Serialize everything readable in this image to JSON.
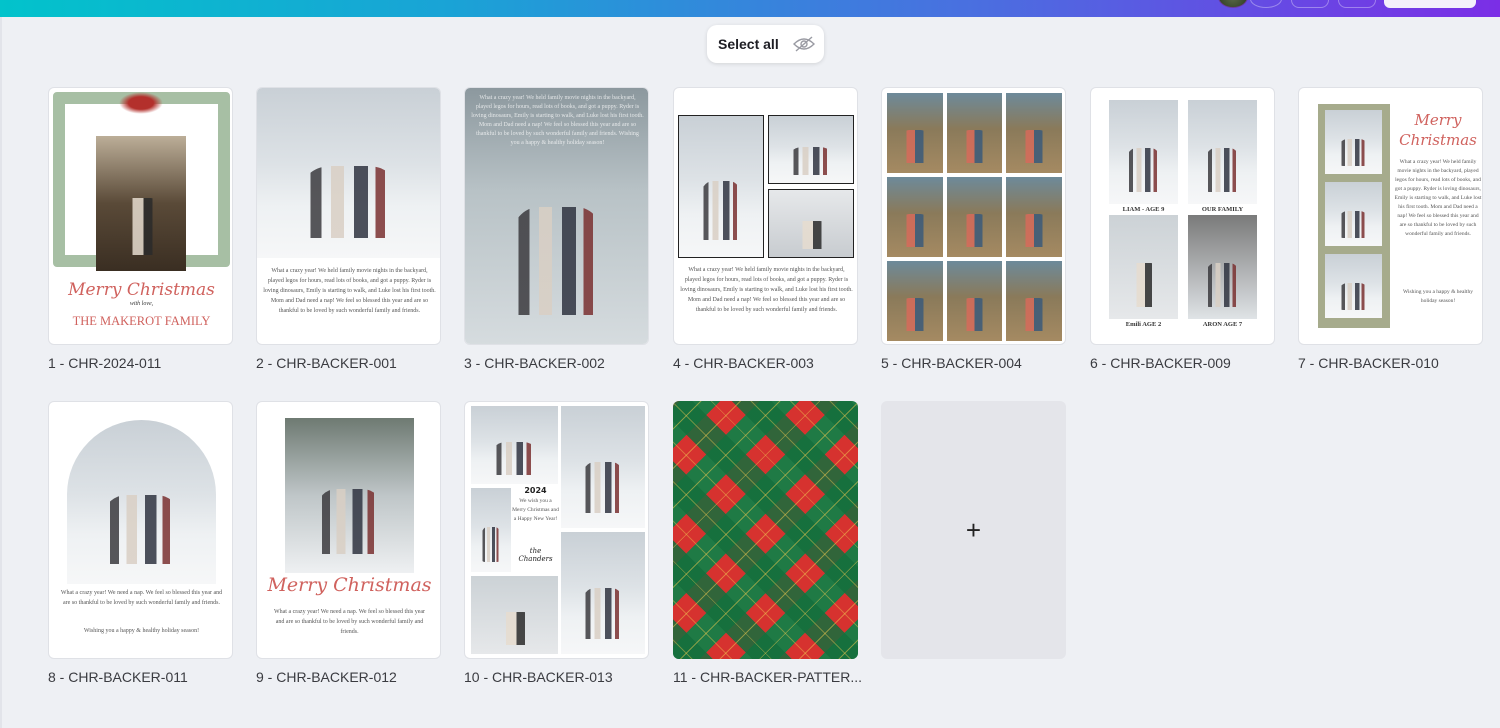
{
  "toolbar": {
    "select_all_label": "Select all",
    "hide_icon": "eye-slash-icon",
    "add_page_icon": "plus-icon",
    "add_page_symbol": "+"
  },
  "colors": {
    "gradient_start": "#02c3cb",
    "gradient_end": "#7b2ee6",
    "background": "#eef0f4"
  },
  "pages": [
    {
      "label": "1 - CHR-2024-011",
      "title": "Merry Christmas",
      "subtitle": "with love,",
      "family": "THE MAKEROT FAMILY"
    },
    {
      "label": "2 - CHR-BACKER-001",
      "body": "What a crazy year! We held family movie nights in the backyard, played legos for hours, read lots of books, and got a puppy. Ryder is loving dinosaurs, Emily is starting to walk, and Luke lost his first tooth. Mom and Dad need a nap! We feel so blessed this year and are so thankful to be loved by such wonderful family and friends."
    },
    {
      "label": "3 - CHR-BACKER-002",
      "body": "What a crazy year! We held family movie nights in the backyard, played legos for hours, read lots of books, and got a puppy. Ryder is loving dinosaurs, Emily is starting to walk, and Luke lost his first tooth. Mom and Dad need a nap! We feel so blessed this year and are so thankful to be loved by such wonderful family and friends. Wishing you a happy & healthy holiday season!"
    },
    {
      "label": "4 - CHR-BACKER-003",
      "body": "What a crazy year! We held family movie nights in the backyard, played legos for hours, read lots of books, and got a puppy. Ryder is loving dinosaurs, Emily is starting to walk, and Luke lost his first tooth. Mom and Dad need a nap! We feel so blessed this year and are so thankful to be loved by such wonderful family and friends."
    },
    {
      "label": "5 - CHR-BACKER-004"
    },
    {
      "label": "6 - CHR-BACKER-009",
      "captions": [
        "LIAM - AGE 9",
        "OUR FAMILY",
        "Emili AGE 2",
        "ARON AGE 7"
      ]
    },
    {
      "label": "7 - CHR-BACKER-010",
      "title": "Merry Christmas",
      "body": "What a crazy year! We held family movie nights in the backyard, played legos for hours, read lots of books, and got a puppy. Ryder is loving dinosaurs, Emily is starting to walk, and Luke lost his first tooth. Mom and Dad need a nap! We feel so blessed this year and are so thankful to be loved by such wonderful family and friends.",
      "closing": "Wishing you a happy & healthy holiday season!"
    },
    {
      "label": "8 - CHR-BACKER-011",
      "body": "What a crazy year! We need a nap. We feel so blessed this year and are so thankful to be loved by such wonderful family and friends.",
      "closing": "Wishing you a happy & healthy holiday season!"
    },
    {
      "label": "9 - CHR-BACKER-012",
      "title": "Merry Christmas",
      "body": "What a crazy year! We need a nap. We feel so blessed this year and are so thankful to be loved by such wonderful family and friends."
    },
    {
      "label": "10 - CHR-BACKER-013",
      "year": "2024",
      "body": "We wish you a Merry Christmas and a Happy New Year!",
      "signature": "the Chanders"
    },
    {
      "label": "11 - CHR-BACKER-PATTER..."
    }
  ]
}
